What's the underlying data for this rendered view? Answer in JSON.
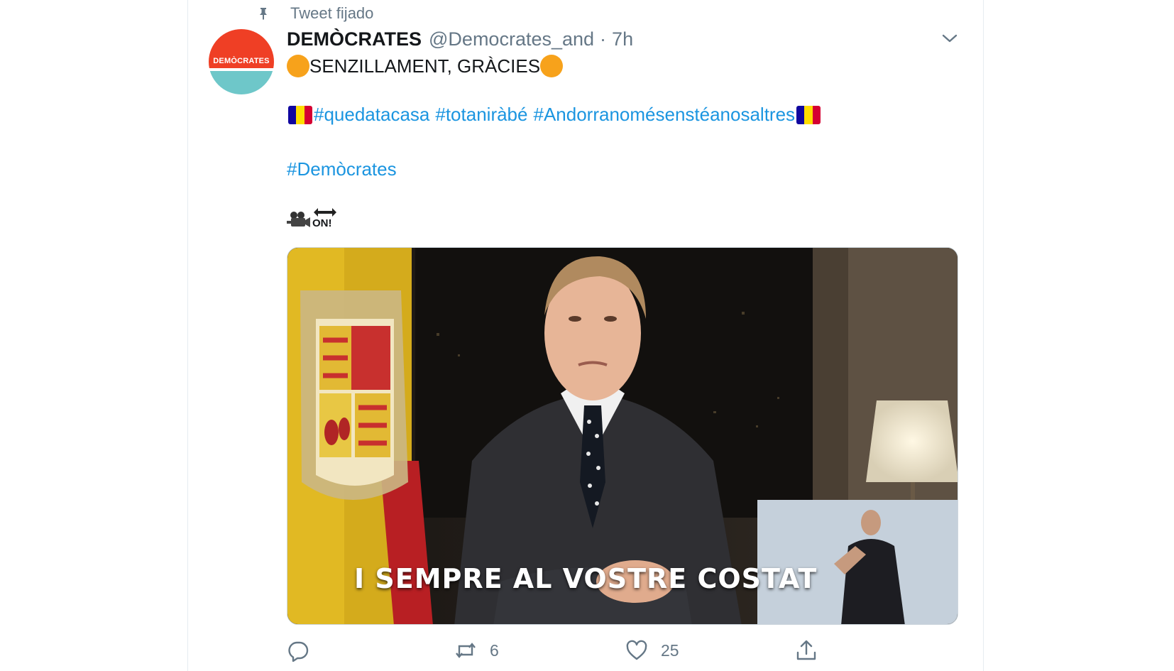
{
  "tweet": {
    "pinned_label": "Tweet fijado",
    "avatar_text": "DEMÒCRATES",
    "display_name": "DEMÒCRATES",
    "handle": "@Democrates_and",
    "separator": "·",
    "time": "7h",
    "text_line1": "SENZILLAMENT, GRÀCIES",
    "hashtags": [
      "#quedatacasa",
      "#totaniràbé",
      "#Andorranomésenstéanosaltres"
    ],
    "hashtag_footer": "#Demòcrates",
    "on_label": "ON!"
  },
  "video": {
    "caption": "I SEMPRE AL VOSTRE COSTAT"
  },
  "actions": {
    "reply_count": "",
    "retweet_count": "6",
    "like_count": "25"
  },
  "colors": {
    "link": "#1b95e0",
    "muted": "#657786",
    "emoji_orange": "#f7a21b",
    "flag_blue": "#10069f",
    "flag_yellow": "#fedd00",
    "flag_red": "#d50032"
  },
  "icons": [
    "pin-icon",
    "chevron-down-icon",
    "movie-camera-icon",
    "on-arrow-icon",
    "reply-icon",
    "retweet-icon",
    "like-icon",
    "share-icon"
  ]
}
